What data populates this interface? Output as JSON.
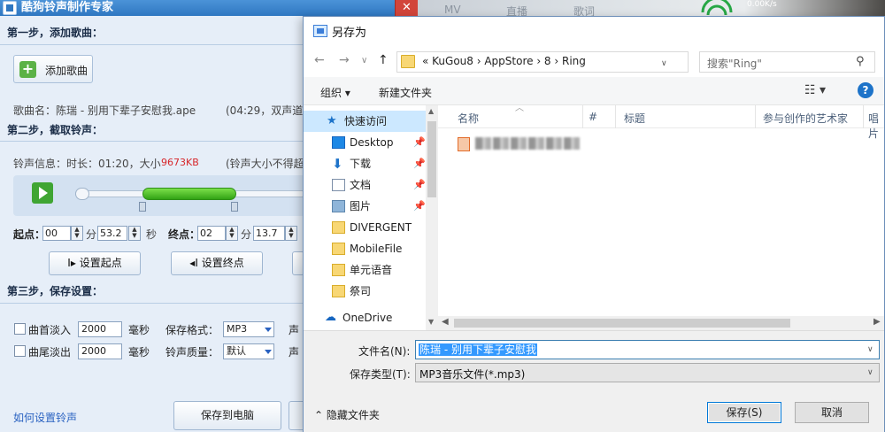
{
  "background_app": {
    "title": "酷狗铃声制作专家",
    "close": "✕",
    "step1": "第一步，添加歌曲：",
    "add_song_label": "添加歌曲",
    "song_info": "歌曲名：陈瑞 - 别用下辈子安慰我.ape",
    "song_info_extra": "(04:29，双声道，",
    "step2": "第二步，截取铃声：",
    "ring_info_label": "铃声信息：时长：01:20，大小",
    "ring_size": "9673KB",
    "ring_limit": "(铃声大小不得超",
    "start_label": "起点：",
    "start_min": "00",
    "min_unit": "分",
    "start_sec": "53.2",
    "sec_unit": "秒",
    "end_label": "终点：",
    "end_min": "02",
    "end_min_unit": "分",
    "end_sec": "13.7",
    "set_start": "设置起点",
    "set_end": "设置终点",
    "step3": "第三步，保存设置：",
    "fade_in": "曲首淡入",
    "fade_out": "曲尾淡出",
    "fade_in_value": "2000",
    "fade_out_value": "2000",
    "ms_unit": "毫秒",
    "format_label": "保存格式：",
    "format_value": "MP3",
    "quality_label": "铃声质量：",
    "quality_value": "默认",
    "voice_label1": "声",
    "voice_label2": "声",
    "howto_link": "如何设置铃声",
    "save_to_pc": "保存到电脑"
  },
  "background_strip": {
    "tabs": [
      "MV",
      "直播",
      "歌词"
    ],
    "speed": "0.00K/s"
  },
  "dialog": {
    "title": "另存为",
    "nav_back": "←",
    "nav_forward": "→",
    "nav_dropdown": "∨",
    "nav_up": "↑",
    "breadcrumb": "«  KuGou8  ›  AppStore  ›  8  ›  Ring",
    "search_placeholder": "搜索\"Ring\"",
    "organize": "组织 ▾",
    "new_folder": "新建文件夹",
    "help": "?",
    "sidebar": [
      {
        "label": "快速访问",
        "icon": "star-icon",
        "pinned": false
      },
      {
        "label": "Desktop",
        "icon": "desktop-icon",
        "pinned": true
      },
      {
        "label": "下载",
        "icon": "download-icon",
        "pinned": true
      },
      {
        "label": "文档",
        "icon": "document-icon",
        "pinned": true
      },
      {
        "label": "图片",
        "icon": "pictures-icon",
        "pinned": true
      },
      {
        "label": "DIVERGENT",
        "icon": "folder-icon",
        "pinned": false
      },
      {
        "label": "MobileFile",
        "icon": "folder-icon",
        "pinned": false
      },
      {
        "label": "单元语音",
        "icon": "folder-icon",
        "pinned": false
      },
      {
        "label": "祭司",
        "icon": "folder-icon",
        "pinned": false
      },
      {
        "label": "OneDrive",
        "icon": "cloud-icon",
        "pinned": false
      }
    ],
    "columns": [
      "名称",
      "#",
      "标题",
      "参与创作的艺术家",
      "唱片"
    ],
    "filename_label": "文件名(N):",
    "filename_value": "陈瑞 - 别用下辈子安慰我",
    "filetype_label": "保存类型(T):",
    "filetype_value": "MP3音乐文件(*.mp3)",
    "hide_folders": "隐藏文件夹",
    "save_button": "保存(S)",
    "cancel_button": "取消"
  },
  "colors": {
    "titlebar": "#2f77c1",
    "accent_blue": "#0078d7",
    "selection": "#3399ff",
    "play_green": "#3fa533"
  }
}
